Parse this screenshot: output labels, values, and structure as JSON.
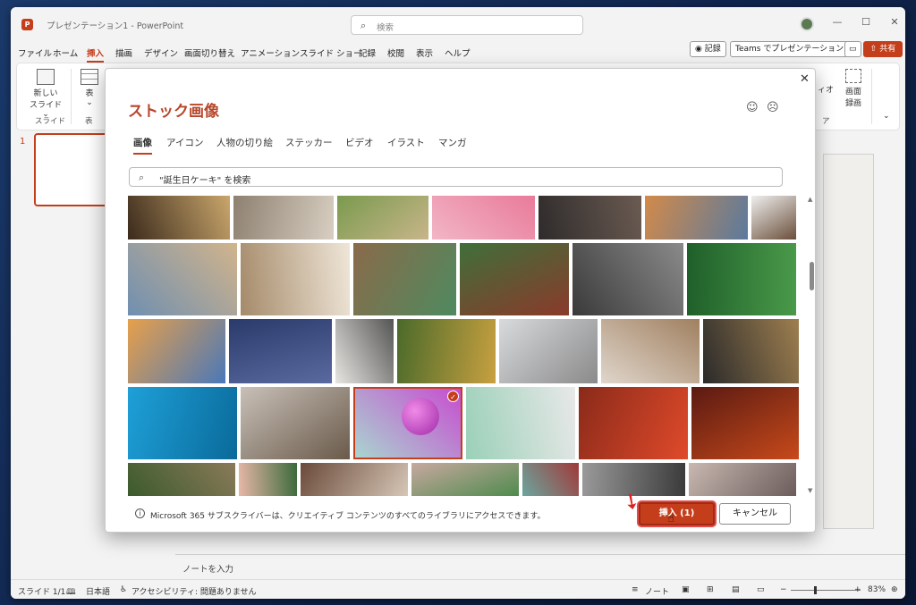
{
  "window": {
    "title": "プレゼンテーション1 - PowerPoint",
    "search_placeholder": "検索",
    "app_icon_letter": "P"
  },
  "menu": {
    "tabs": [
      "ファイル",
      "ホーム",
      "挿入",
      "描画",
      "デザイン",
      "画面切り替え",
      "アニメーション",
      "スライド ショー",
      "記録",
      "校閲",
      "表示",
      "ヘルプ"
    ],
    "active_tab": "挿入",
    "record_label": "記録",
    "teams_label": "Teams でプレゼンテーション",
    "share_label": "共有"
  },
  "ribbon": {
    "new_slide_line1": "新しい",
    "new_slide_line2": "スライド ⌄",
    "slide_group": "スライド",
    "table_label": "表",
    "table_group": "表",
    "screen_record_line1": "画面",
    "screen_record_line2": "録画",
    "partial_video": "ィオ",
    "partial_group": "ア"
  },
  "slides_pane": {
    "slide_number": "1"
  },
  "notes": {
    "placeholder": "ノートを入力"
  },
  "status": {
    "slide_indicator": "スライド 1/1",
    "language": "日本語",
    "accessibility": "アクセシビリティ: 問題ありません",
    "notes_toggle": "ノート",
    "zoom": "83%"
  },
  "dialog": {
    "title": "ストック画像",
    "tabs": [
      "画像",
      "アイコン",
      "人物の切り絵",
      "ステッカー",
      "ビデオ",
      "イラスト",
      "マンガ"
    ],
    "active_tab": "画像",
    "search_value": "\"誕生日ケーキ\" を検索",
    "footer_text": "Microsoft 365 サブスクライバーは、クリエイティブ コンテンツのすべてのライブラリにアクセスできます。",
    "insert_label": "挿入 (1)",
    "cancel_label": "キャンセル",
    "selected_count": 1
  },
  "images": {
    "rows": [
      [
        {
          "name": "basketball-player"
        },
        {
          "name": "woman-holding-box"
        },
        {
          "name": "dog-in-field"
        },
        {
          "name": "pink-confetti"
        },
        {
          "name": "business-hands"
        },
        {
          "name": "desert-cactus"
        },
        {
          "name": "doctor-portrait"
        }
      ],
      [
        {
          "name": "photo-prints-collage"
        },
        {
          "name": "warehouse-worker"
        },
        {
          "name": "paint-palette-desk"
        },
        {
          "name": "pagoda-garden"
        },
        {
          "name": "kettlebell-workout"
        },
        {
          "name": "green-leaves"
        }
      ],
      [
        {
          "name": "city-skyline"
        },
        {
          "name": "blueberries"
        },
        {
          "name": "bed-top-view"
        },
        {
          "name": "aerial-forest"
        },
        {
          "name": "office-workspace"
        },
        {
          "name": "ceramic-plates"
        },
        {
          "name": "people-at-laptops"
        }
      ],
      [
        {
          "name": "stethoscope-blue"
        },
        {
          "name": "cafe-chairs"
        },
        {
          "name": "pink-sphere",
          "selected": true
        },
        {
          "name": "paper-figures"
        },
        {
          "name": "red-smoke"
        },
        {
          "name": "theater-stage"
        }
      ],
      [
        {
          "name": "man-with-plants"
        },
        {
          "name": "cactus-pink"
        },
        {
          "name": "bakery-shelves"
        },
        {
          "name": "market-stall"
        },
        {
          "name": "woman-teal-wall"
        },
        {
          "name": "spiral-staircase"
        },
        {
          "name": "woman-field"
        }
      ]
    ]
  }
}
